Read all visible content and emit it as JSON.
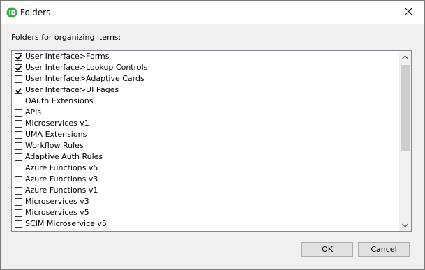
{
  "window": {
    "title": "Folders",
    "app_icon": "app-logo-icon",
    "close_icon": "close-icon"
  },
  "prompt": "Folders for organizing items:",
  "folders": [
    {
      "label": "User Interface>Forms",
      "checked": true
    },
    {
      "label": "User Interface>Lookup Controls",
      "checked": true
    },
    {
      "label": "User Interface>Adaptive Cards",
      "checked": false
    },
    {
      "label": "User Interface>UI Pages",
      "checked": true
    },
    {
      "label": "OAuth Extensions",
      "checked": false
    },
    {
      "label": "APIs",
      "checked": false
    },
    {
      "label": "Microservices v1",
      "checked": false
    },
    {
      "label": "UMA Extensions",
      "checked": false
    },
    {
      "label": "Workflow Rules",
      "checked": false
    },
    {
      "label": "Adaptive Auth Rules",
      "checked": false
    },
    {
      "label": "Azure Functions v5",
      "checked": false
    },
    {
      "label": "Azure Functions v3",
      "checked": false
    },
    {
      "label": "Azure Functions v1",
      "checked": false
    },
    {
      "label": "Microservices v3",
      "checked": false
    },
    {
      "label": "Microservices v5",
      "checked": false
    },
    {
      "label": "SCIM Microservice v5",
      "checked": false
    }
  ],
  "buttons": {
    "ok": "OK",
    "cancel": "Cancel"
  },
  "colors": {
    "app_icon": "#3aa845",
    "titlebar": "#ffffff",
    "dialog_bg": "#f0f0f0"
  }
}
